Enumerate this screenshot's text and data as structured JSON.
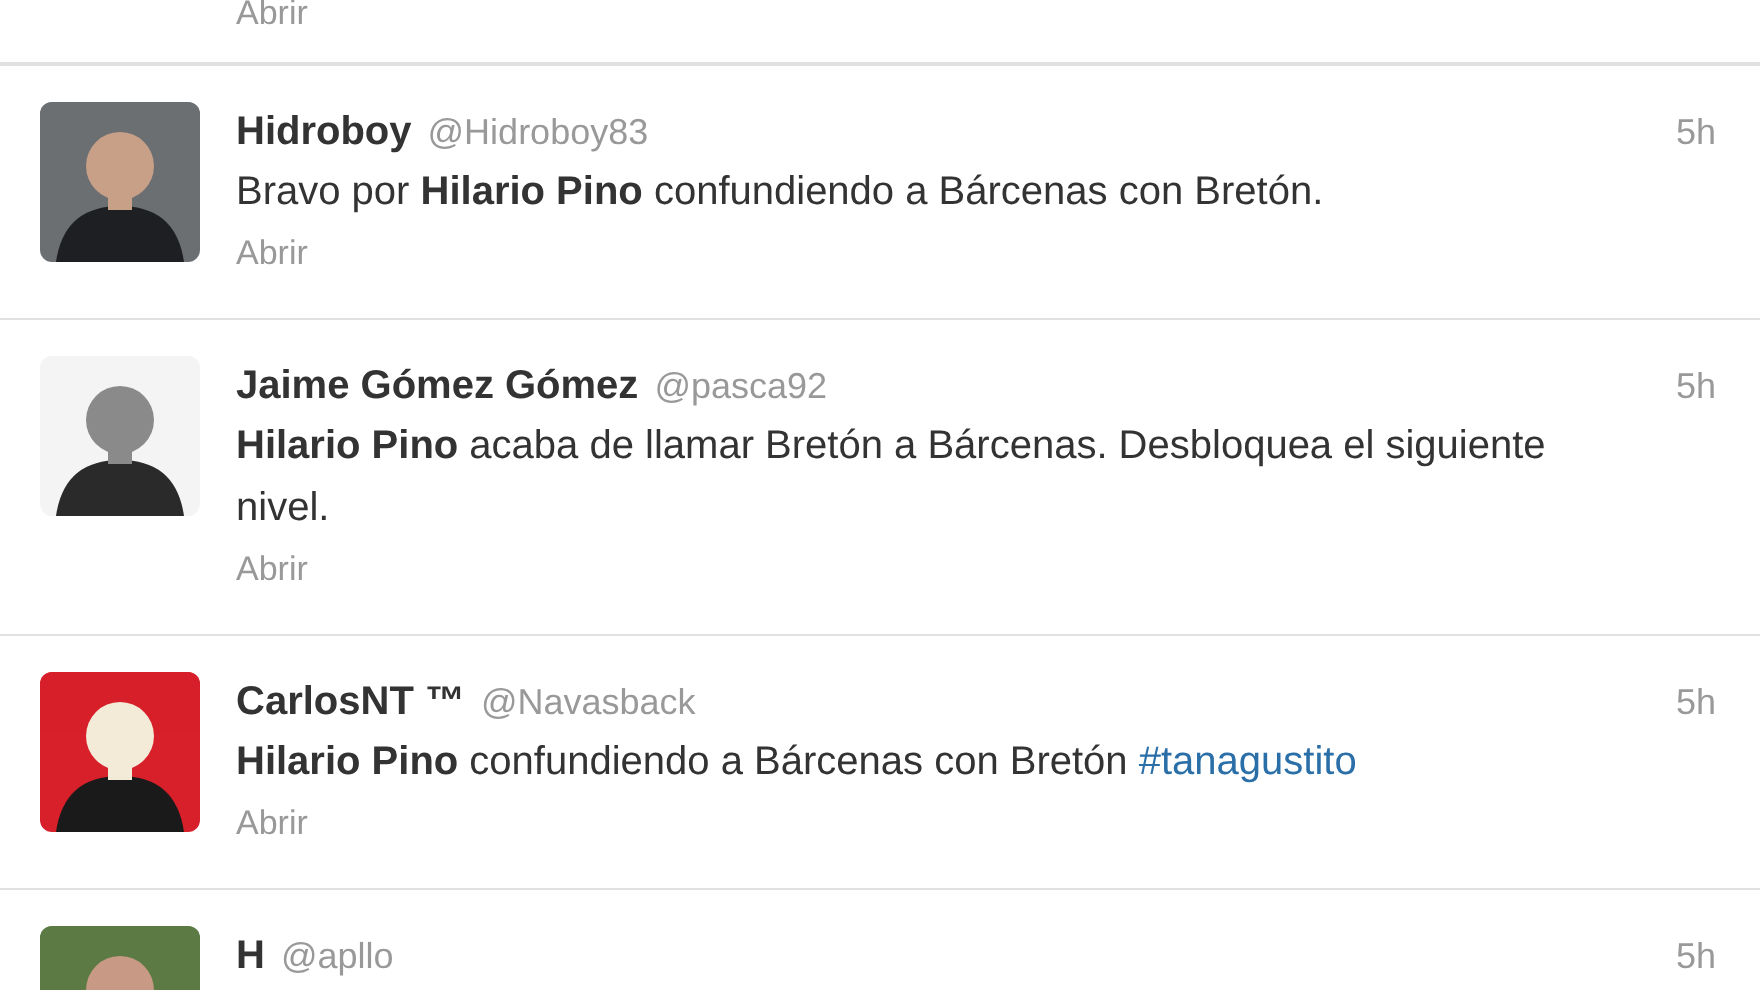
{
  "top_partial": {
    "open_link": "Abrir"
  },
  "tweets": [
    {
      "name": "Hidroboy",
      "handle": "@Hidroboy83",
      "time": "5h",
      "text": "Bravo por **Hilario Pino** confundiendo a Bárcenas con Bretón.",
      "open_link": "Abrir"
    },
    {
      "name": "Jaime Gómez Gómez",
      "handle": "@pasca92",
      "time": "5h",
      "text": "**Hilario Pino** acaba de llamar Bretón a Bárcenas. Desbloquea el siguiente nivel.",
      "open_link": "Abrir"
    },
    {
      "name": "CarlosNT ™",
      "handle": "@Navasback",
      "time": "5h",
      "text": "**Hilario Pino** confundiendo a Bárcenas con Bretón",
      "hashtag": "#tanagustito",
      "open_link": "Abrir"
    },
    {
      "name": "H",
      "handle": "@apllo",
      "time": "5h"
    }
  ]
}
